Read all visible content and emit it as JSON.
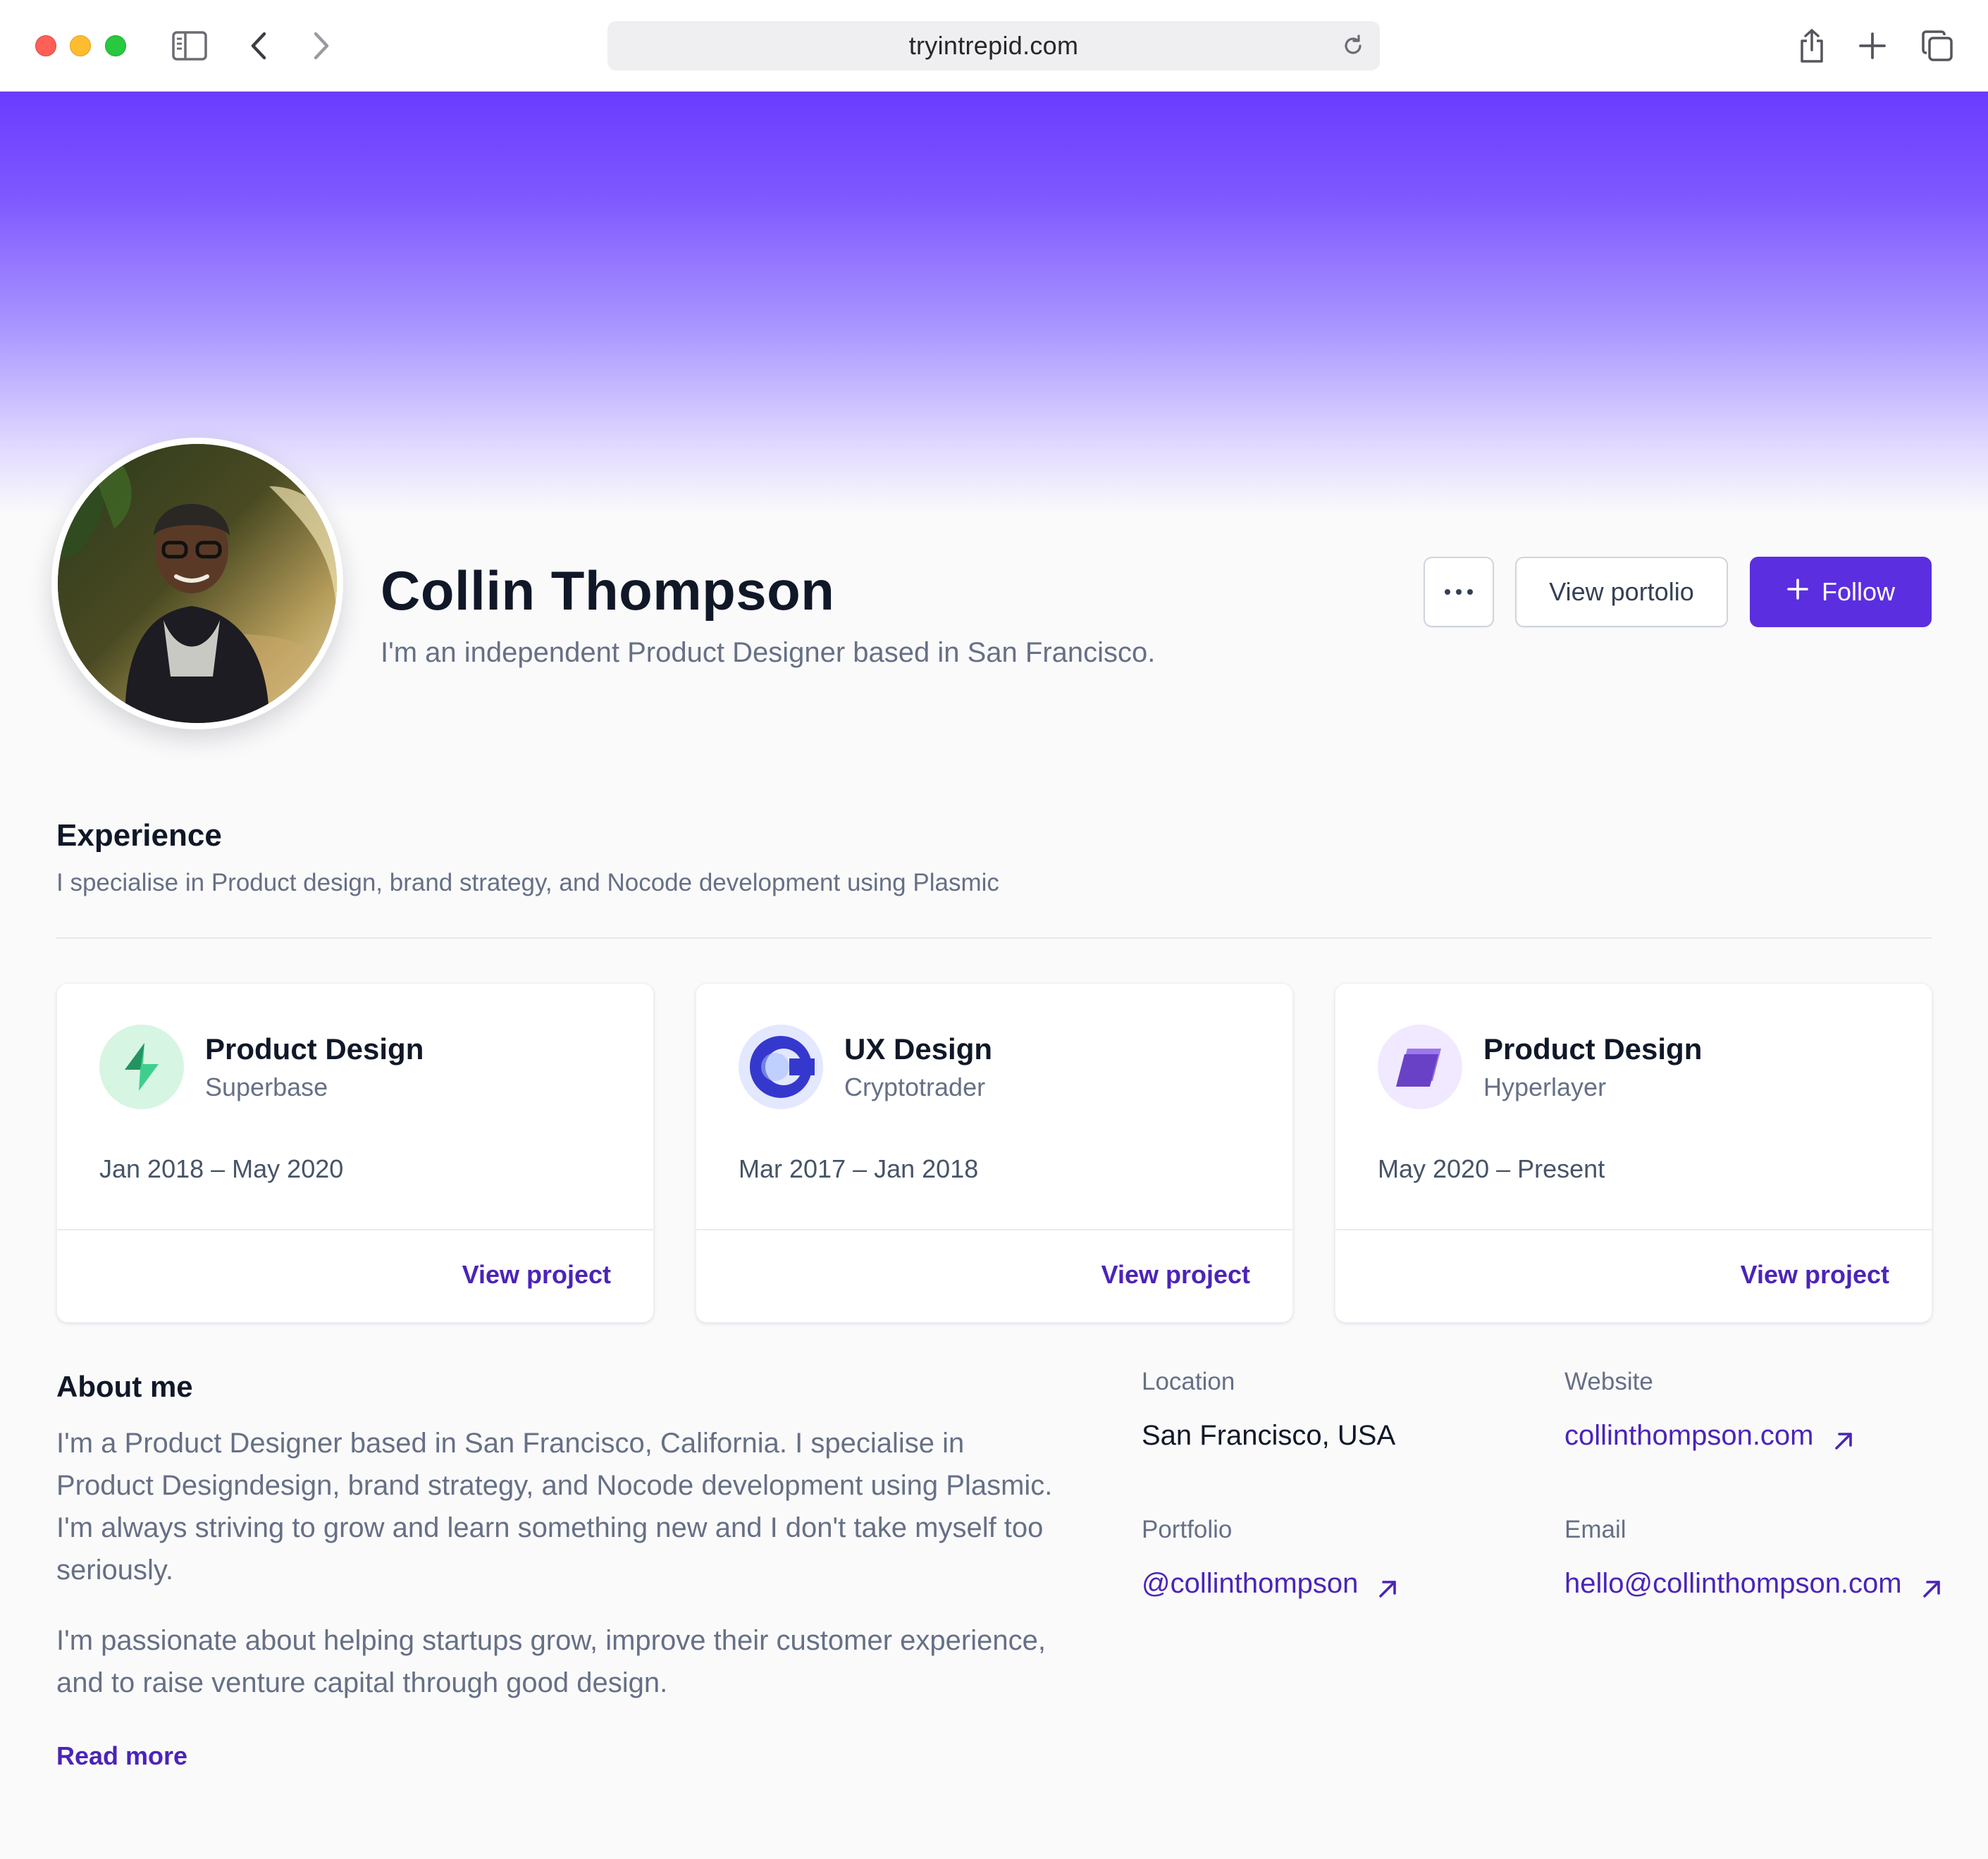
{
  "browser": {
    "url": "tryintrepid.com"
  },
  "profile": {
    "name": "Collin Thompson",
    "tagline": "I'm an independent Product Designer based in San Francisco.",
    "avatar_alt": "Profile photo of Collin Thompson"
  },
  "actions": {
    "more_icon": "more-horizontal-icon",
    "portfolio_label": "View portolio",
    "follow_label": "Follow",
    "follow_icon": "plus-icon"
  },
  "experience": {
    "title": "Experience",
    "subtitle": "I specialise in Product design, brand strategy, and Nocode development using Plasmic",
    "cards": [
      {
        "title": "Product Design",
        "company": "Superbase",
        "dates": "Jan 2018 – May 2020",
        "link": "View project",
        "logo_icon": "supabase-bolt-icon",
        "logo_bg": "#d7f5e3",
        "logo_color": "#3ecf8e"
      },
      {
        "title": "UX Design",
        "company": "Cryptotrader",
        "dates": "Mar 2017 – Jan 2018",
        "link": "View project",
        "logo_icon": "c-ring-icon",
        "logo_bg": "#e3e8ff",
        "logo_color": "#3538cd"
      },
      {
        "title": "Product Design",
        "company": "Hyperlayer",
        "dates": "May 2020 – Present",
        "link": "View project",
        "logo_icon": "layers-icon",
        "logo_bg": "#f1e9ff",
        "logo_color": "#6941c6"
      }
    ]
  },
  "about": {
    "title": "About me",
    "paragraph_1": "I'm a Product Designer based in San Francisco, California. I specialise in Product Designdesign, brand strategy, and Nocode development using Plasmic. I'm always striving to grow and learn something new and I don't take myself too seriously.",
    "paragraph_2": "I'm passionate about helping startups grow, improve their customer experience, and to raise venture capital through good design.",
    "read_more": "Read more"
  },
  "details": {
    "location_label": "Location",
    "location_value": "San Francisco, USA",
    "website_label": "Website",
    "website_value": "collinthompson.com",
    "portfolio_label": "Portfolio",
    "portfolio_value": "@collinthompson",
    "email_label": "Email",
    "email_value": "hello@collinthompson.com"
  },
  "colors": {
    "accent": "#5b2ee0",
    "link": "#4b24b8",
    "hero_top": "#6a3bff"
  }
}
